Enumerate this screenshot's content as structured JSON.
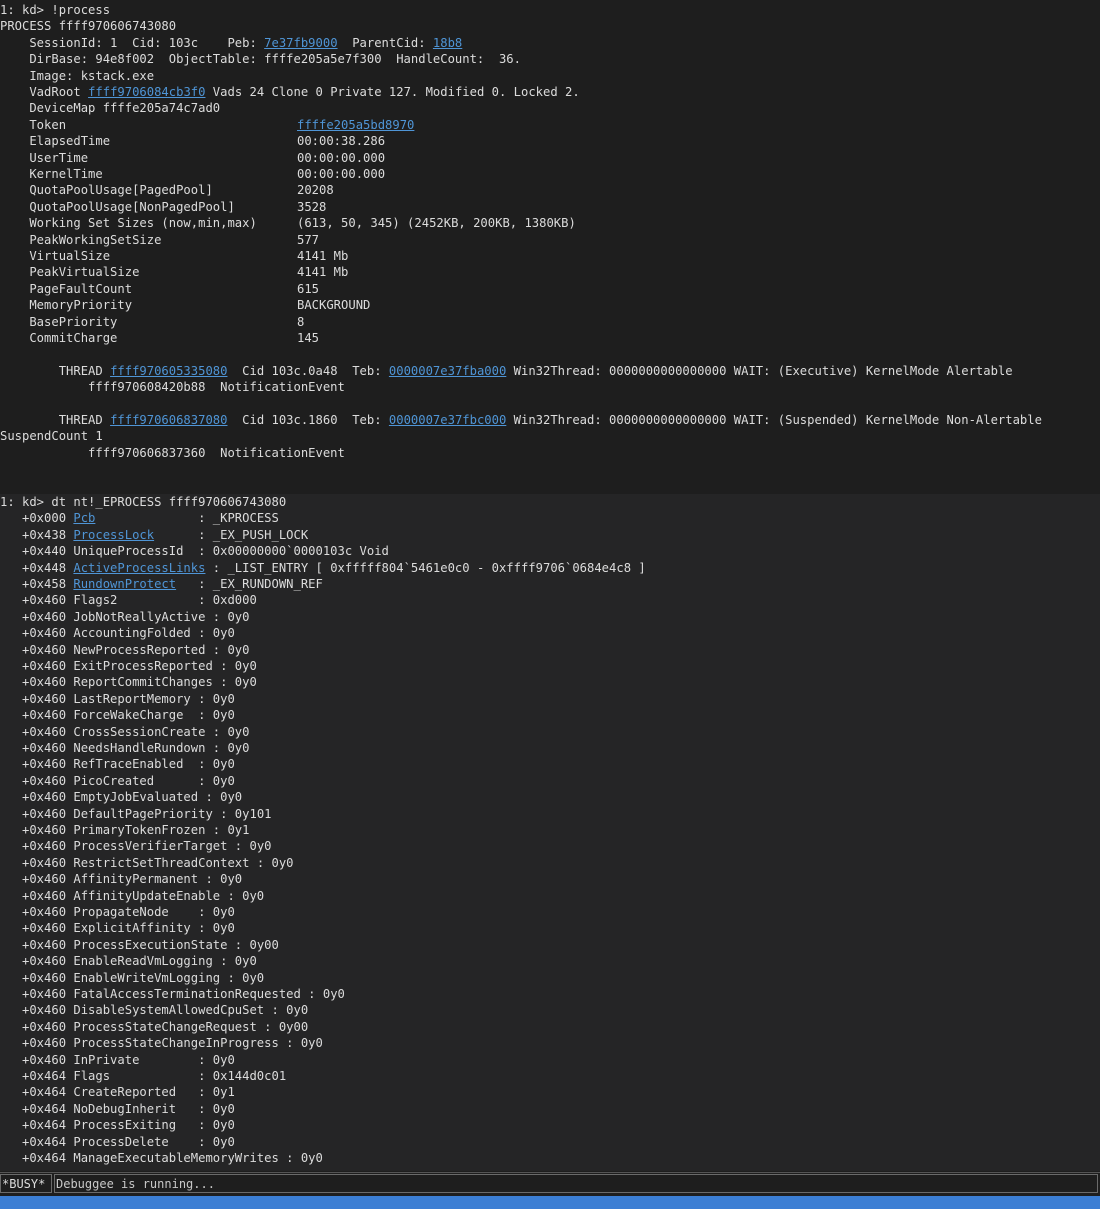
{
  "process_output": {
    "line1": "1: kd> !process",
    "line2": "PROCESS ffff970606743080",
    "line3": {
      "t1": "    SessionId: 1  Cid: 103c    Peb: ",
      "l1": "7e37fb9000",
      "t2": "  ParentCid: ",
      "l2": "18b8"
    },
    "line4": "    DirBase: 94e8f002  ObjectTable: ffffe205a5e7f300  HandleCount:  36.",
    "line5": "    Image: kstack.exe",
    "line6": {
      "t1": "    VadRoot ",
      "l1": "ffff9706084cb3f0",
      "t2": " Vads 24 Clone 0 Private 127. Modified 0. Locked 2."
    },
    "line7": "    DeviceMap ffffe205a74c7ad0",
    "stats": [
      {
        "key": "    Token",
        "val": "ffffe205a5bd8970",
        "link": true
      },
      {
        "key": "    ElapsedTime",
        "val": "00:00:38.286"
      },
      {
        "key": "    UserTime",
        "val": "00:00:00.000"
      },
      {
        "key": "    KernelTime",
        "val": "00:00:00.000"
      },
      {
        "key": "    QuotaPoolUsage[PagedPool]",
        "val": "20208"
      },
      {
        "key": "    QuotaPoolUsage[NonPagedPool]",
        "val": "3528"
      },
      {
        "key": "    Working Set Sizes (now,min,max)",
        "val": "(613, 50, 345) (2452KB, 200KB, 1380KB)"
      },
      {
        "key": "    PeakWorkingSetSize",
        "val": "577"
      },
      {
        "key": "    VirtualSize",
        "val": "4141 Mb"
      },
      {
        "key": "    PeakVirtualSize",
        "val": "4141 Mb"
      },
      {
        "key": "    PageFaultCount",
        "val": "615"
      },
      {
        "key": "    MemoryPriority",
        "val": "BACKGROUND"
      },
      {
        "key": "    BasePriority",
        "val": "8"
      },
      {
        "key": "    CommitCharge",
        "val": "145"
      }
    ],
    "thread1": {
      "t1": "        THREAD ",
      "l1": "ffff970605335080",
      "t2": "  Cid 103c.0a48  Teb: ",
      "l2": "0000007e37fba000",
      "t3": " Win32Thread: 0000000000000000 WAIT: (Executive) KernelMode Alertable",
      "wait": "            ffff970608420b88  NotificationEvent"
    },
    "thread2": {
      "t1": "        THREAD ",
      "l1": "ffff970606837080",
      "t2": "  Cid 103c.1860  Teb: ",
      "l2": "0000007e37fbc000",
      "t3": " Win32Thread: 0000000000000000 WAIT: (Suspended) KernelMode Non-Alertable",
      "wrap": "SuspendCount 1",
      "wait": "            ffff970606837360  NotificationEvent"
    }
  },
  "dt_output": {
    "cmd": "1: kd> dt nt!_EPROCESS ffff970606743080",
    "rows": [
      {
        "off": "   +0x000 ",
        "name": "Pcb",
        "link": true,
        "rest": "              : _KPROCESS"
      },
      {
        "off": "   +0x438 ",
        "name": "ProcessLock",
        "link": true,
        "rest": "      : _EX_PUSH_LOCK"
      },
      {
        "off": "   +0x440 ",
        "name": "UniqueProcessId",
        "rest": "  : 0x00000000`0000103c Void"
      },
      {
        "off": "   +0x448 ",
        "name": "ActiveProcessLinks",
        "link": true,
        "rest": " : _LIST_ENTRY [ 0xfffff804`5461e0c0 - 0xffff9706`0684e4c8 ]"
      },
      {
        "off": "   +0x458 ",
        "name": "RundownProtect",
        "link": true,
        "rest": "   : _EX_RUNDOWN_REF"
      },
      {
        "off": "   +0x460 ",
        "name": "Flags2",
        "rest": "           : 0xd000"
      },
      {
        "off": "   +0x460 ",
        "name": "JobNotReallyActive",
        "rest": " : 0y0"
      },
      {
        "off": "   +0x460 ",
        "name": "AccountingFolded",
        "rest": " : 0y0"
      },
      {
        "off": "   +0x460 ",
        "name": "NewProcessReported",
        "rest": " : 0y0"
      },
      {
        "off": "   +0x460 ",
        "name": "ExitProcessReported",
        "rest": " : 0y0"
      },
      {
        "off": "   +0x460 ",
        "name": "ReportCommitChanges",
        "rest": " : 0y0"
      },
      {
        "off": "   +0x460 ",
        "name": "LastReportMemory",
        "rest": " : 0y0"
      },
      {
        "off": "   +0x460 ",
        "name": "ForceWakeCharge",
        "rest": "  : 0y0"
      },
      {
        "off": "   +0x460 ",
        "name": "CrossSessionCreate",
        "rest": " : 0y0"
      },
      {
        "off": "   +0x460 ",
        "name": "NeedsHandleRundown",
        "rest": " : 0y0"
      },
      {
        "off": "   +0x460 ",
        "name": "RefTraceEnabled",
        "rest": "  : 0y0"
      },
      {
        "off": "   +0x460 ",
        "name": "PicoCreated",
        "rest": "      : 0y0"
      },
      {
        "off": "   +0x460 ",
        "name": "EmptyJobEvaluated",
        "rest": " : 0y0"
      },
      {
        "off": "   +0x460 ",
        "name": "DefaultPagePriority",
        "rest": " : 0y101"
      },
      {
        "off": "   +0x460 ",
        "name": "PrimaryTokenFrozen",
        "rest": " : 0y1"
      },
      {
        "off": "   +0x460 ",
        "name": "ProcessVerifierTarget",
        "rest": " : 0y0"
      },
      {
        "off": "   +0x460 ",
        "name": "RestrictSetThreadContext",
        "rest": " : 0y0"
      },
      {
        "off": "   +0x460 ",
        "name": "AffinityPermanent",
        "rest": " : 0y0"
      },
      {
        "off": "   +0x460 ",
        "name": "AffinityUpdateEnable",
        "rest": " : 0y0"
      },
      {
        "off": "   +0x460 ",
        "name": "PropagateNode",
        "rest": "    : 0y0"
      },
      {
        "off": "   +0x460 ",
        "name": "ExplicitAffinity",
        "rest": " : 0y0"
      },
      {
        "off": "   +0x460 ",
        "name": "ProcessExecutionState",
        "rest": " : 0y00"
      },
      {
        "off": "   +0x460 ",
        "name": "EnableReadVmLogging",
        "rest": " : 0y0"
      },
      {
        "off": "   +0x460 ",
        "name": "EnableWriteVmLogging",
        "rest": " : 0y0"
      },
      {
        "off": "   +0x460 ",
        "name": "FatalAccessTerminationRequested",
        "rest": " : 0y0"
      },
      {
        "off": "   +0x460 ",
        "name": "DisableSystemAllowedCpuSet",
        "rest": " : 0y0"
      },
      {
        "off": "   +0x460 ",
        "name": "ProcessStateChangeRequest",
        "rest": " : 0y00"
      },
      {
        "off": "   +0x460 ",
        "name": "ProcessStateChangeInProgress",
        "rest": " : 0y0"
      },
      {
        "off": "   +0x460 ",
        "name": "InPrivate",
        "rest": "        : 0y0"
      },
      {
        "off": "   +0x464 ",
        "name": "Flags",
        "rest": "            : 0x144d0c01"
      },
      {
        "off": "   +0x464 ",
        "name": "CreateReported",
        "rest": "   : 0y1"
      },
      {
        "off": "   +0x464 ",
        "name": "NoDebugInherit",
        "rest": "   : 0y0"
      },
      {
        "off": "   +0x464 ",
        "name": "ProcessExiting",
        "rest": "   : 0y0"
      },
      {
        "off": "   +0x464 ",
        "name": "ProcessDelete",
        "rest": "    : 0y0"
      },
      {
        "off": "   +0x464 ",
        "name": "ManageExecutableMemoryWrites",
        "rest": " : 0y0"
      }
    ]
  },
  "command_bar": {
    "busy_label": "*BUSY*",
    "status_text": "Debuggee is running..."
  },
  "colors": {
    "background": "#1e1e1e",
    "dt_background": "#252526",
    "text": "#dcdcdc",
    "link": "#4f95d6",
    "status_bar": "#3b7ed4"
  }
}
